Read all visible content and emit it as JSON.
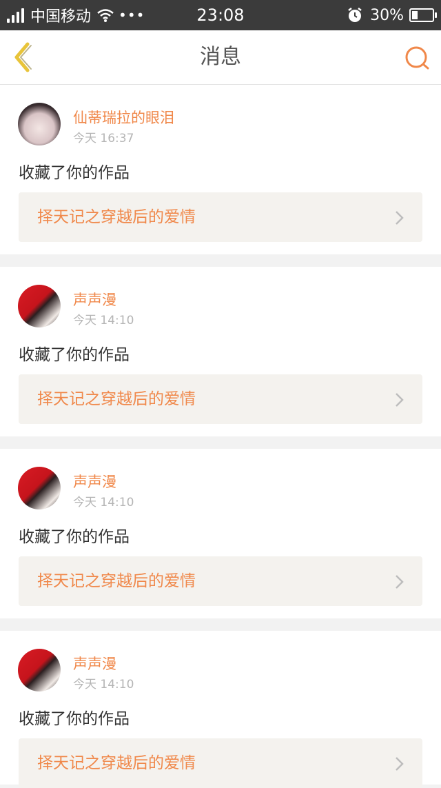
{
  "status_bar": {
    "carrier": "中国移动",
    "dots": "•••",
    "time": "23:08",
    "battery_percent": "30%",
    "battery_level": 0.3
  },
  "header": {
    "title": "消息"
  },
  "messages": [
    {
      "username": "仙蒂瑞拉的眼泪",
      "time": "今天 16:37",
      "action": "收藏了你的作品",
      "work_title": "择天记之穿越后的爱情"
    },
    {
      "username": "声声漫",
      "time": "今天 14:10",
      "action": "收藏了你的作品",
      "work_title": "择天记之穿越后的爱情"
    },
    {
      "username": "声声漫",
      "time": "今天 14:10",
      "action": "收藏了你的作品",
      "work_title": "择天记之穿越后的爱情"
    },
    {
      "username": "声声漫",
      "time": "今天 14:10",
      "action": "收藏了你的作品",
      "work_title": "择天记之穿越后的爱情"
    }
  ],
  "colors": {
    "accent": "#f0884a",
    "back_icon": "#e8c43a",
    "status_bar_bg": "#3b3b3b",
    "page_bg": "#f2f2f2"
  },
  "icons": [
    "back-chevron-icon",
    "search-icon",
    "wifi-icon",
    "alarm-icon",
    "battery-icon",
    "signal-icon",
    "chevron-right-icon"
  ]
}
